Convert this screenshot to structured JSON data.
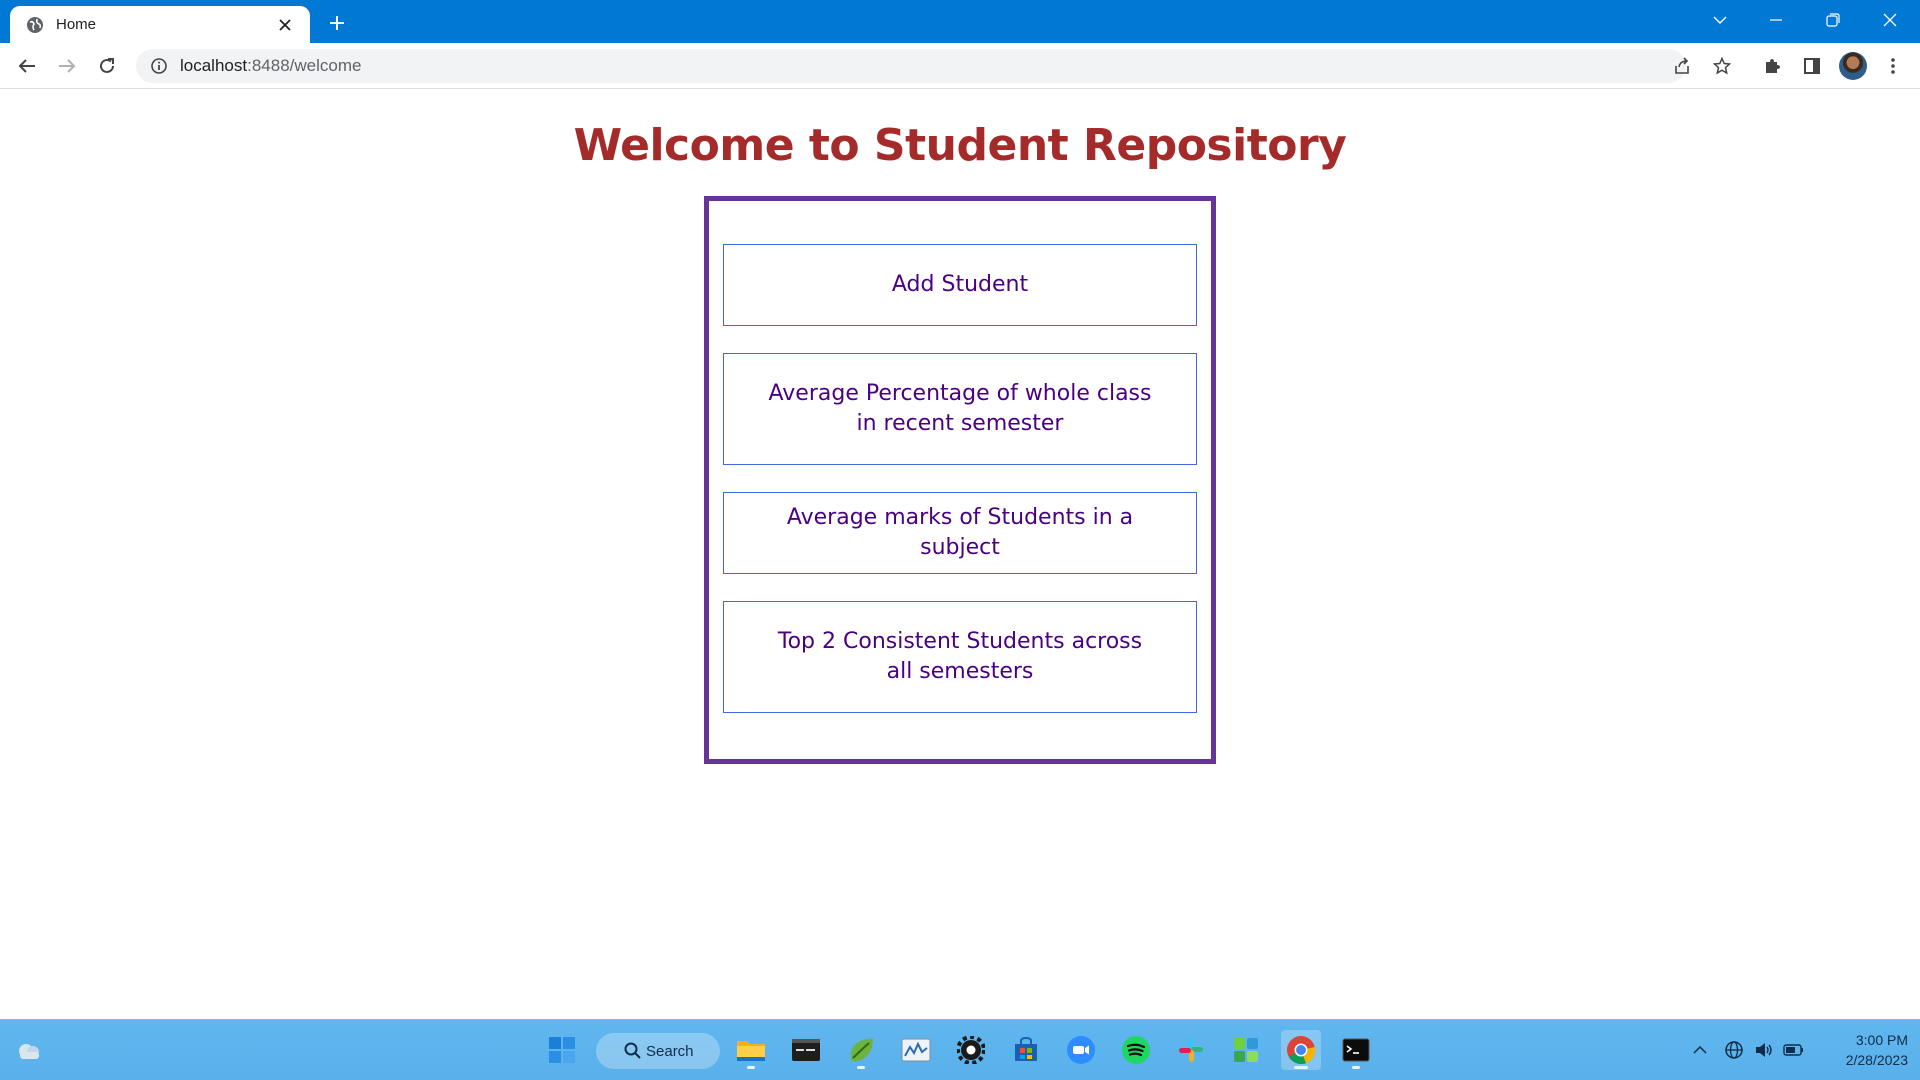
{
  "browser": {
    "tab": {
      "title": "Home"
    },
    "address": {
      "host": "localhost",
      "port_path": ":8488/welcome"
    }
  },
  "page": {
    "heading": "Welcome to Student Repository",
    "menu": [
      {
        "label": "Add Student"
      },
      {
        "label": "Average Percentage of whole class in recent semester"
      },
      {
        "label": "Average marks of Students in a subject"
      },
      {
        "label": "Top 2 Consistent Students across all semesters"
      }
    ]
  },
  "taskbar": {
    "search_label": "Search",
    "clock": {
      "time": "3:00 PM",
      "date": "2/28/2023"
    }
  },
  "colors": {
    "heading": "#a52a2a",
    "panel_border": "#663399",
    "button_border": "#4169e1",
    "button_text": "#4b0082",
    "titlebar": "#0078d4"
  }
}
